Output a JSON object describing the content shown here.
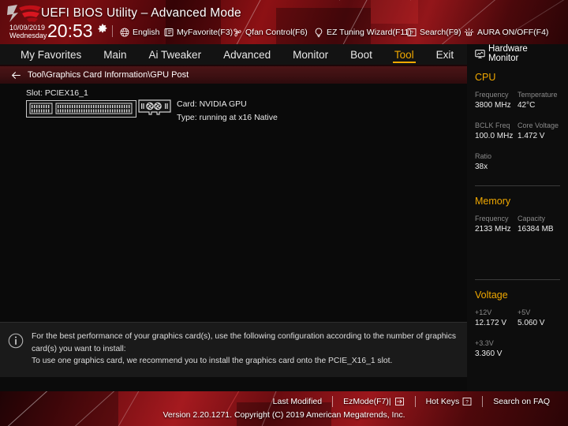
{
  "header": {
    "logo": "rog-logo",
    "title": "UEFI BIOS Utility – Advanced Mode",
    "date": "10/09/2019",
    "weekday": "Wednesday",
    "time": "20:53",
    "gear_icon": "gear-icon",
    "items": [
      {
        "label": "English",
        "icon": "globe-icon"
      },
      {
        "label": "MyFavorite(F3)",
        "icon": "favorites-icon"
      },
      {
        "label": "Qfan Control(F6)",
        "icon": "fan-icon"
      },
      {
        "label": "EZ Tuning Wizard(F11)",
        "icon": "lightbulb-icon"
      },
      {
        "label": "Search(F9)",
        "icon": "question-box-icon"
      },
      {
        "label": "AURA ON/OFF(F4)",
        "icon": "aura-light-icon"
      }
    ]
  },
  "tabs": [
    {
      "label": "My Favorites",
      "active": false
    },
    {
      "label": "Main",
      "active": false
    },
    {
      "label": "Ai Tweaker",
      "active": false
    },
    {
      "label": "Advanced",
      "active": false
    },
    {
      "label": "Monitor",
      "active": false
    },
    {
      "label": "Boot",
      "active": false
    },
    {
      "label": "Tool",
      "active": true
    },
    {
      "label": "Exit",
      "active": false
    }
  ],
  "breadcrumb": {
    "back_icon": "back-arrow-icon",
    "path": "Tool\\Graphics Card Information\\GPU Post"
  },
  "main": {
    "slot_label": "Slot: PCIEX16_1",
    "slot_icon": "pcie-slot-icon",
    "card_icon": "graphics-card-icon",
    "card": "Card: NVIDIA GPU",
    "type": "Type: running at x16 Native"
  },
  "info": {
    "icon": "info-icon",
    "line1": "For the best performance of your graphics card(s), use the following configuration according to the number of graphics card(s) you want to install:",
    "line2": "To use one graphics card, we recommend you to install the graphics card onto the PCIE_X16_1 slot."
  },
  "hardware_monitor": {
    "title": "Hardware Monitor",
    "title_icon": "monitor-icon",
    "sections": [
      {
        "name": "CPU",
        "items": [
          {
            "key": "Frequency",
            "value": "3800 MHz"
          },
          {
            "key": "Temperature",
            "value": "42°C"
          },
          {
            "key": "BCLK Freq",
            "value": "100.0 MHz"
          },
          {
            "key": "Core Voltage",
            "value": "1.472 V"
          },
          {
            "key": "Ratio",
            "value": "38x"
          }
        ]
      },
      {
        "name": "Memory",
        "items": [
          {
            "key": "Frequency",
            "value": "2133 MHz"
          },
          {
            "key": "Capacity",
            "value": "16384 MB"
          }
        ]
      },
      {
        "name": "Voltage",
        "items": [
          {
            "key": "+12V",
            "value": "12.172 V"
          },
          {
            "key": "+5V",
            "value": "5.060 V"
          },
          {
            "key": "+3.3V",
            "value": "3.360 V"
          }
        ]
      }
    ]
  },
  "footer": {
    "items": [
      {
        "label": "Last Modified",
        "icon": ""
      },
      {
        "label": "EzMode(F7)|",
        "icon": "exit-arrow-icon"
      },
      {
        "label": "Hot Keys",
        "icon": "question-key-icon"
      },
      {
        "label": "Search on FAQ",
        "icon": ""
      }
    ],
    "copyright": "Version 2.20.1271. Copyright (C) 2019 American Megatrends, Inc."
  },
  "colors": {
    "accent": "#f0a800",
    "header_red": "#8d1114",
    "panel_bg": "#0a0a0a",
    "info_bg": "#1a1a1a"
  }
}
